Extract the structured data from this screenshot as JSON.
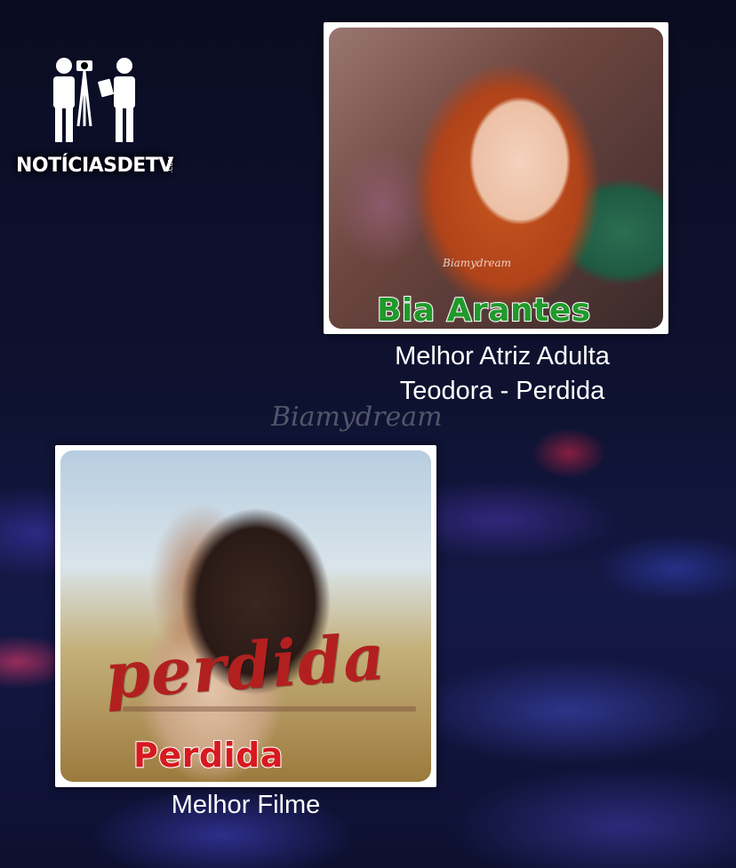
{
  "logo": {
    "text": "NOTÍCIASDETV",
    "suffix": ".COM",
    "icon": "camera-crew-icon"
  },
  "nominations": [
    {
      "name": "Bia Arantes",
      "name_color": "#1f9a2b",
      "photo_watermark": "Biamydream",
      "category": "Melhor Atriz Adulta",
      "role": "Teodora - Perdida"
    },
    {
      "name": "Perdida",
      "name_color": "#d71920",
      "poster_title": "perdida",
      "category": "Melhor Filme"
    }
  ],
  "watermark": "Biamydream",
  "colors": {
    "background": "#0b0d24",
    "caption": "#ffffff"
  }
}
